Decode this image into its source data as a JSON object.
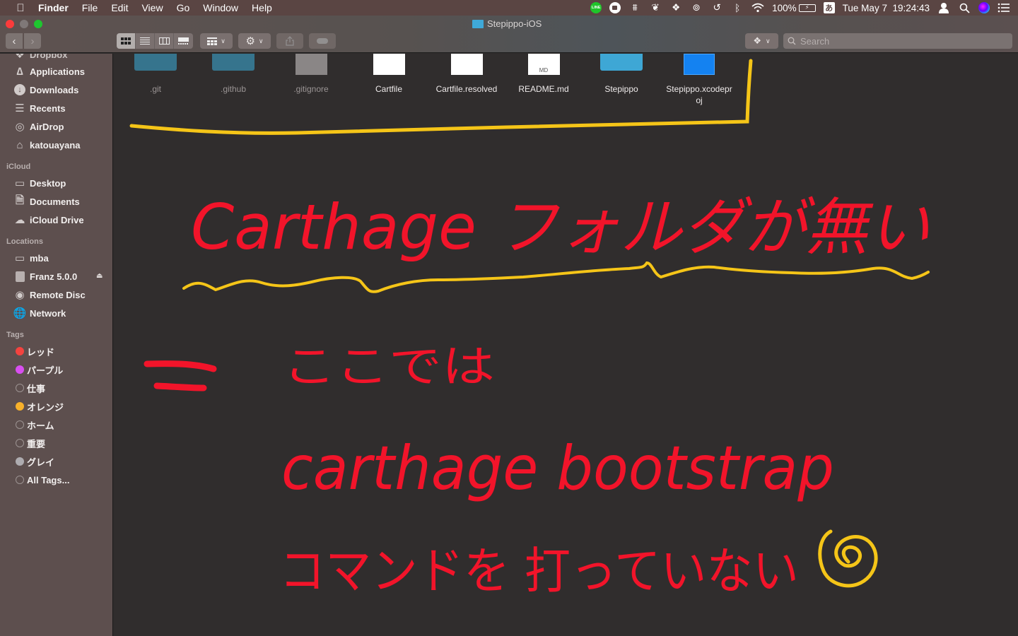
{
  "menubar": {
    "apple_icon": "",
    "app_name": "Finder",
    "menus": [
      "File",
      "Edit",
      "View",
      "Go",
      "Window",
      "Help"
    ],
    "status_icons": [
      "line-icon",
      "zoom-icon",
      "moo-icon",
      "evernote-icon",
      "dropbox-icon",
      "creative-cloud-icon",
      "time-machine-icon",
      "bluetooth-icon",
      "wifi-icon"
    ],
    "battery_text": "100%",
    "input_method": "あ",
    "clock": "Tue May 7  19:24:43"
  },
  "window": {
    "title": "Stepippo-iOS",
    "search_placeholder": "Search"
  },
  "sidebar": {
    "partial_top": "Dropbox",
    "favorites": [
      {
        "label": "Applications",
        "icon": "applications-icon"
      },
      {
        "label": "Downloads",
        "icon": "downloads-icon"
      },
      {
        "label": "Recents",
        "icon": "recents-icon"
      },
      {
        "label": "AirDrop",
        "icon": "airdrop-icon"
      },
      {
        "label": "katouayana",
        "icon": "home-icon"
      }
    ],
    "icloud_header": "iCloud",
    "icloud": [
      {
        "label": "Desktop",
        "icon": "desktop-icon"
      },
      {
        "label": "Documents",
        "icon": "documents-icon"
      },
      {
        "label": "iCloud Drive",
        "icon": "cloud-icon"
      }
    ],
    "locations_header": "Locations",
    "locations": [
      {
        "label": "mba",
        "icon": "laptop-icon"
      },
      {
        "label": "Franz 5.0.0",
        "icon": "disk-icon"
      },
      {
        "label": "Remote Disc",
        "icon": "remote-disc-icon"
      },
      {
        "label": "Network",
        "icon": "network-icon"
      }
    ],
    "tags_header": "Tags",
    "tags": [
      {
        "label": "レッド",
        "color": "#f4433f"
      },
      {
        "label": "パープル",
        "color": "#d84ff0"
      },
      {
        "label": "仕事",
        "color": ""
      },
      {
        "label": "オレンジ",
        "color": "#f8b12a"
      },
      {
        "label": "ホーム",
        "color": ""
      },
      {
        "label": "重要",
        "color": ""
      },
      {
        "label": "グレイ",
        "color": "#aeacb0"
      },
      {
        "label": "All Tags...",
        "color": ""
      }
    ]
  },
  "files": [
    {
      "name": ".git",
      "kind": "folder",
      "hidden": true
    },
    {
      "name": ".github",
      "kind": "folder",
      "hidden": true
    },
    {
      "name": ".gitignore",
      "kind": "doc",
      "hidden": true
    },
    {
      "name": "Cartfile",
      "kind": "doc",
      "hidden": false
    },
    {
      "name": "Cartfile.resolved",
      "kind": "doc",
      "hidden": false
    },
    {
      "name": "README.md",
      "kind": "doc",
      "badge": "MD",
      "hidden": false
    },
    {
      "name": "Stepippo",
      "kind": "folder",
      "hidden": false
    },
    {
      "name": "Stepippo.xcodeproj",
      "kind": "xcodeproj",
      "hidden": false
    }
  ],
  "annotations": {
    "line1": "Carthage フォルダが無い",
    "line2_symbol": "=",
    "line2": "ここでは",
    "line3": "carthage bootstrap",
    "line4": "コマンドを 打っていない",
    "colors": {
      "ink": "#f2142a",
      "highlight": "#f5c518"
    }
  }
}
